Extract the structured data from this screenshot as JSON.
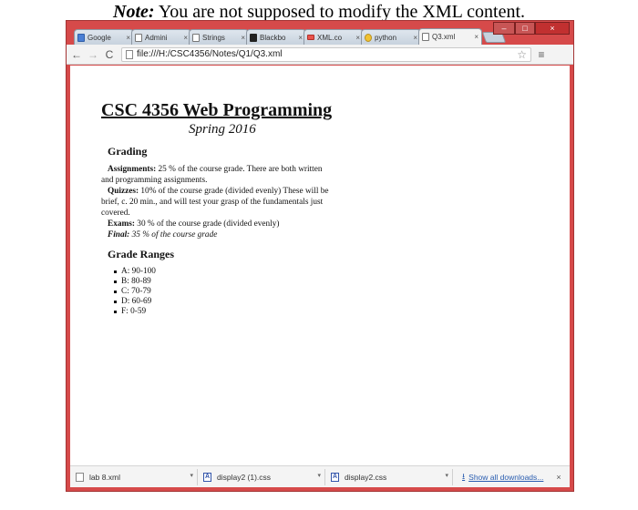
{
  "note": {
    "label": "Note:",
    "text": "You are not supposed to modify the XML content."
  },
  "tabs": [
    {
      "label": "Google",
      "icon": "google-icon",
      "active": false
    },
    {
      "label": "Admini",
      "icon": "page-icon",
      "active": false
    },
    {
      "label": "Strings",
      "icon": "page-icon",
      "active": false
    },
    {
      "label": "Blackbo",
      "icon": "blackboard-icon",
      "active": false
    },
    {
      "label": "XML.co",
      "icon": "xml-icon",
      "active": false
    },
    {
      "label": "python",
      "icon": "python-icon",
      "active": false
    },
    {
      "label": "Q3.xml",
      "icon": "page-icon",
      "active": true
    }
  ],
  "tab_close_glyph": "×",
  "window_controls": {
    "minimize": "–",
    "maximize": "□",
    "close": "×"
  },
  "toolbar": {
    "back": "←",
    "forward": "→",
    "reload": "C",
    "url": "file:///H:/CSC4356/Notes/Q1/Q3.xml",
    "star": "☆",
    "menu": "≡"
  },
  "document": {
    "title": "CSC 4356 Web Programming",
    "term": "Spring 2016",
    "grading_heading": "Grading",
    "assignments_label": "Assignments:",
    "assignments_text": " 25 % of the course grade. There are both written and programming assignments.",
    "quizzes_label": "Quizzes:",
    "quizzes_text": " 10% of the course grade (divided evenly) These will be brief, c. 20 min., and will test your grasp of the fundamentals just covered.",
    "exams_label": "Exams:",
    "exams_text": " 30 % of the course grade (divided evenly)",
    "final_label": "Final:",
    "final_text": " 35 % of the course grade",
    "ranges_heading": "Grade Ranges",
    "ranges": [
      "A: 90-100",
      "B: 80-89",
      "C: 70-79",
      "D: 60-69",
      "F: 0-59"
    ]
  },
  "downloads": {
    "items": [
      {
        "name": "lab 8.xml",
        "icon": "file-icon"
      },
      {
        "name": "display2 (1).css",
        "icon": "css-file-icon"
      },
      {
        "name": "display2.css",
        "icon": "css-file-icon"
      }
    ],
    "dropdown_glyph": "▾",
    "show_all": "Show all downloads...",
    "close": "×"
  },
  "colors": {
    "window_frame": "#d64a4a",
    "link": "#2a5db0"
  }
}
